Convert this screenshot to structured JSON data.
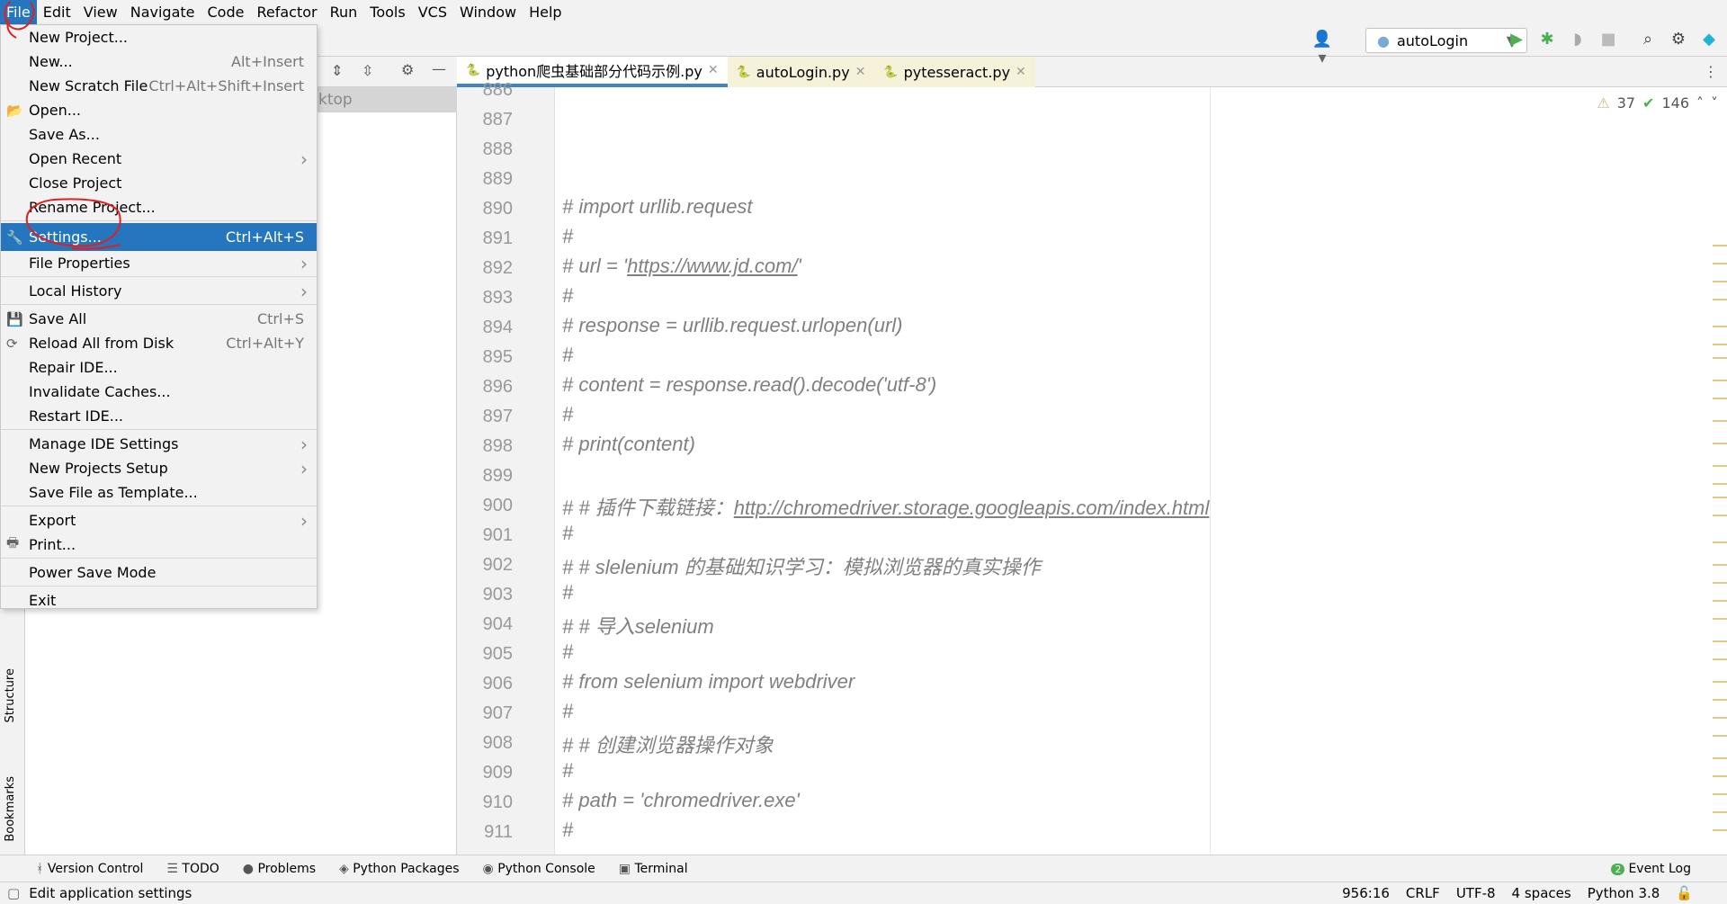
{
  "menubar": [
    "File",
    "Edit",
    "View",
    "Navigate",
    "Code",
    "Refactor",
    "Run",
    "Tools",
    "VCS",
    "Window",
    "Help"
  ],
  "toolbar": {
    "run_config": "autoLogin",
    "icons": [
      "user-icon",
      "python-icon",
      "run-icon",
      "debug-icon",
      "coverage-icon",
      "stop-icon",
      "search-icon",
      "gear-icon",
      "jetbrains-logo-icon"
    ]
  },
  "tabs": [
    {
      "label": "python爬虫基础部分代码示例.py",
      "active": true
    },
    {
      "label": "autoLogin.py"
    },
    {
      "label": "pytesseract.py"
    }
  ],
  "project": {
    "selected_fragment": "ktop"
  },
  "inspections": {
    "warnings": "37",
    "weak_warnings": "146"
  },
  "file_menu": [
    {
      "label": "New Project..."
    },
    {
      "label": "New...",
      "shortcut": "Alt+Insert"
    },
    {
      "label": "New Scratch File",
      "shortcut": "Ctrl+Alt+Shift+Insert"
    },
    {
      "label": "Open...",
      "icon": "folder-icon"
    },
    {
      "label": "Save As..."
    },
    {
      "label": "Open Recent",
      "submenu": true
    },
    {
      "label": "Close Project"
    },
    {
      "label": "Rename Project...",
      "sep_after": true
    },
    {
      "label": "Settings...",
      "shortcut": "Ctrl+Alt+S",
      "icon": "wrench-icon",
      "selected": true
    },
    {
      "label": "File Properties",
      "submenu": true,
      "sep_after": true
    },
    {
      "label": "Local History",
      "submenu": true,
      "sep_after": true
    },
    {
      "label": "Save All",
      "shortcut": "Ctrl+S",
      "icon": "save-icon"
    },
    {
      "label": "Reload All from Disk",
      "shortcut": "Ctrl+Alt+Y",
      "icon": "reload-icon"
    },
    {
      "label": "Repair IDE..."
    },
    {
      "label": "Invalidate Caches..."
    },
    {
      "label": "Restart IDE...",
      "sep_after": true
    },
    {
      "label": "Manage IDE Settings",
      "submenu": true
    },
    {
      "label": "New Projects Setup",
      "submenu": true
    },
    {
      "label": "Save File as Template...",
      "sep_after": true
    },
    {
      "label": "Export",
      "submenu": true
    },
    {
      "label": "Print...",
      "icon": "print-icon",
      "sep_after": true
    },
    {
      "label": "Power Save Mode",
      "sep_after": true
    },
    {
      "label": "Exit"
    }
  ],
  "code": {
    "first_line": 886,
    "lines": [
      "",
      "",
      "",
      "",
      "# import urllib.request",
      "#",
      "# url = 'https://www.jd.com/'",
      "#",
      "# response = urllib.request.urlopen(url)",
      "#",
      "# content = response.read().decode('utf-8')",
      "#",
      "# print(content)",
      "",
      "# # 插件下载链接：http://chromedriver.storage.googleapis.com/index.html",
      "#",
      "# # slelenium 的基础知识学习：模拟浏览器的真实操作",
      "#",
      "# # 导入selenium",
      "#",
      "# from selenium import webdriver",
      "#",
      "# # 创建浏览器操作对象",
      "#",
      "# path = 'chromedriver.exe'",
      "#"
    ]
  },
  "side_tools": [
    "Structure",
    "Bookmarks"
  ],
  "bottom_tools": [
    "Version Control",
    "TODO",
    "Problems",
    "Python Packages",
    "Python Console",
    "Terminal"
  ],
  "event_log": {
    "label": "Event Log",
    "count": "2"
  },
  "status": {
    "message": "Edit application settings",
    "position": "956:16",
    "line_sep": "CRLF",
    "encoding": "UTF-8",
    "indent": "4 spaces",
    "interpreter": "Python 3.8"
  },
  "colors": {
    "accent": "#2675bf",
    "comment": "#808080",
    "run": "#4caf50",
    "annotation": "#e02020"
  }
}
